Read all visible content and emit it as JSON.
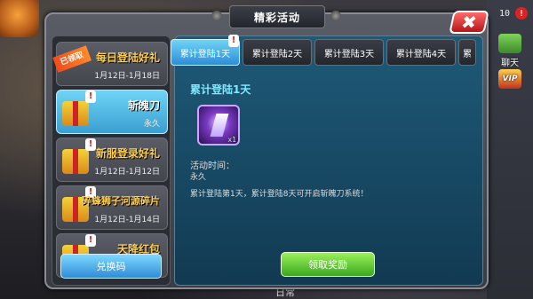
{
  "dialog": {
    "title": "精彩活动",
    "close_label": "✖"
  },
  "status": {
    "time_text": "10",
    "alert_badge": "!"
  },
  "side_buttons": {
    "chat": "聊天",
    "vip": "VIP"
  },
  "bottom": {
    "tab_label": "日常"
  },
  "activities": [
    {
      "name": "每日登陆好礼",
      "date": "1月12日-1月18日",
      "claimed_tag": "已领取"
    },
    {
      "name": "斩魄刀",
      "date": "永久",
      "selected": true
    },
    {
      "name": "新服登录好礼",
      "date": "1月12日-1月12日"
    },
    {
      "name": "碎蜂狮子河源碎片",
      "date": "1月12日-1月14日"
    },
    {
      "name": "天降红包",
      "date": ""
    }
  ],
  "redeem_button": "兑换码",
  "tabs": [
    {
      "label": "累计登陆1天",
      "active": true,
      "badge": "!"
    },
    {
      "label": "累计登陆2天"
    },
    {
      "label": "累计登陆3天"
    },
    {
      "label": "累计登陆4天"
    },
    {
      "label": "累"
    }
  ],
  "content": {
    "title": "累计登陆1天",
    "item_count": "x1",
    "time_label": "活动时间：",
    "time_value": "永久",
    "description": "累计登陆第1天，累计登陆8天可开启斩魄刀系统！",
    "claim_button": "领取奖励"
  },
  "colors": {
    "accent_blue": "#3a9fd0",
    "claim_green": "#3aa81f",
    "close_red": "#b71515"
  }
}
